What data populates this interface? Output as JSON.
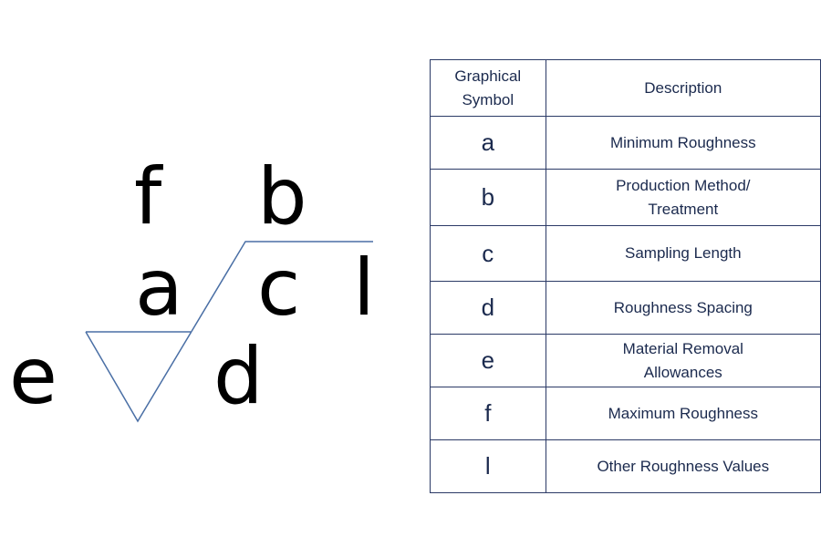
{
  "symbol_letters": {
    "f": "f",
    "b": "b",
    "a": "a",
    "c": "c",
    "l": "l",
    "e": "e",
    "d": "d"
  },
  "colors": {
    "symbol_line": "#4a6fa5",
    "table_text": "#1b2a4e",
    "table_border": "#2b3a66"
  },
  "table": {
    "headers": [
      "Graphical Symbol",
      "Description"
    ],
    "rows": [
      {
        "symbol": "a",
        "description": "Minimum Roughness"
      },
      {
        "symbol": "b",
        "description": "Production Method/ Treatment"
      },
      {
        "symbol": "c",
        "description": "Sampling Length"
      },
      {
        "symbol": "d",
        "description": "Roughness Spacing"
      },
      {
        "symbol": "e",
        "description": "Material Removal Allowances"
      },
      {
        "symbol": "f",
        "description": "Maximum Roughness"
      },
      {
        "symbol": "l",
        "description": "Other Roughness Values"
      }
    ]
  }
}
